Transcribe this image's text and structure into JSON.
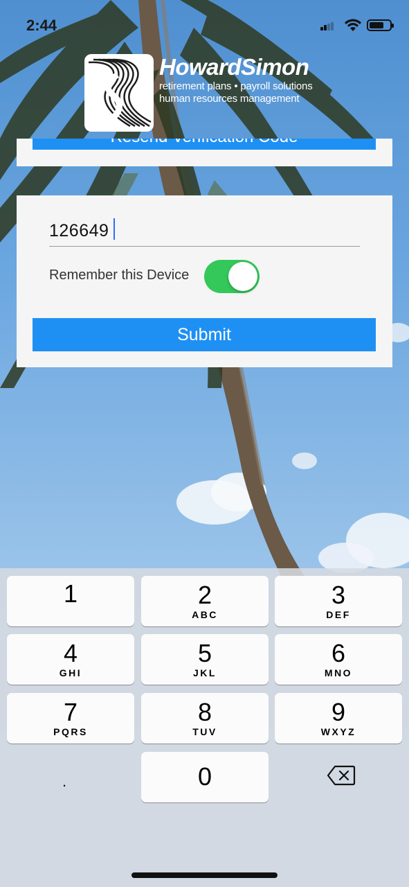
{
  "status_bar": {
    "time": "2:44",
    "battery_level": 0.7
  },
  "logo": {
    "name": "HowardSimon",
    "tagline_1": "retirement plans • payroll solutions",
    "tagline_2": "human resources management"
  },
  "verification": {
    "resend_label": "Resend Verification Code",
    "code_value": "126649",
    "remember_label": "Remember this Device",
    "remember_on": true,
    "submit_label": "Submit"
  },
  "keypad": {
    "keys": [
      {
        "num": "1",
        "letters": ""
      },
      {
        "num": "2",
        "letters": "ABC"
      },
      {
        "num": "3",
        "letters": "DEF"
      },
      {
        "num": "4",
        "letters": "GHI"
      },
      {
        "num": "5",
        "letters": "JKL"
      },
      {
        "num": "6",
        "letters": "MNO"
      },
      {
        "num": "7",
        "letters": "PQRS"
      },
      {
        "num": "8",
        "letters": "TUV"
      },
      {
        "num": "9",
        "letters": "WXYZ"
      },
      {
        "num": "0",
        "letters": ""
      }
    ],
    "dot": "."
  },
  "colors": {
    "button_blue": "#1e90f4",
    "toggle_green": "#34c759",
    "card_bg": "#f5f5f5"
  }
}
